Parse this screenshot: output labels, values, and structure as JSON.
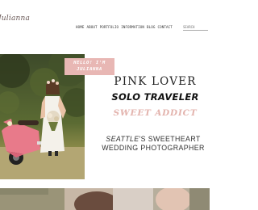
{
  "header": {
    "logo_text": "Julianna",
    "nav": [
      "HOME",
      "ABOUT",
      "PORTFOLIO",
      "INFORMATION",
      "BLOG",
      "CONTACT"
    ],
    "search_placeholder": "SEARCH"
  },
  "hero": {
    "badge_line1": "HELLO! I'M",
    "badge_line2": "JULIANNA",
    "line1": "PINK LOVER",
    "line2": "SOLO TRAVELER",
    "line3": "SWEET ADDICT",
    "tagline_city": "SEATTLE",
    "tagline_rest": "'S SWEETHEART",
    "tagline_line2": "WEDDING PHOTOGRAPHER"
  },
  "colors": {
    "accent_pink": "#e8b7b4",
    "text_dark": "#222222",
    "scooter_pink": "#e87a8a"
  },
  "icons": [
    "scooter-photo",
    "bride-photo",
    "couple-photo"
  ]
}
